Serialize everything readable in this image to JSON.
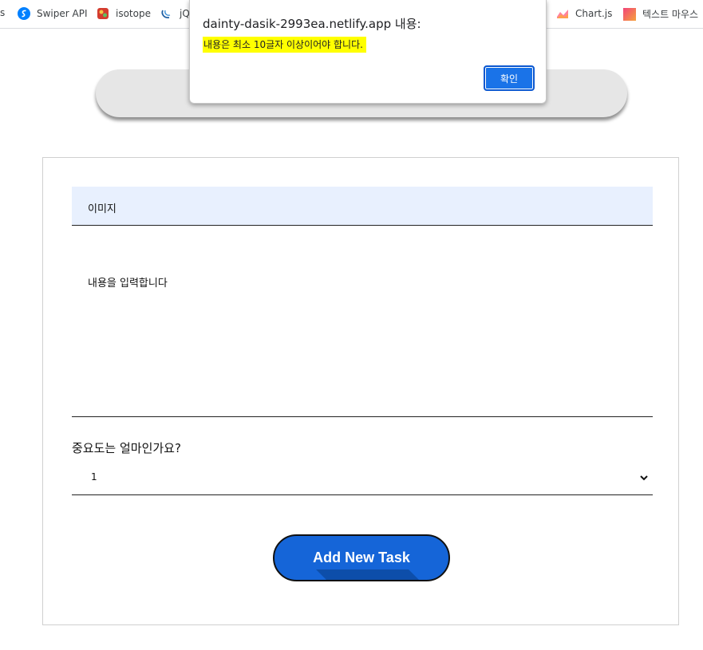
{
  "bookmarks": {
    "truncated_first": "s",
    "items": [
      {
        "label": "Swiper API",
        "icon": "swiper-icon"
      },
      {
        "label": "isotope",
        "icon": "isotope-icon"
      },
      {
        "label": "jQ",
        "icon": "jquery-icon"
      },
      {
        "label": "Chart.js",
        "icon": "chartjs-icon"
      },
      {
        "label": "텍스트 마우스",
        "icon": "bookmark-page-icon"
      }
    ]
  },
  "dialog": {
    "title": "dainty-dasik-2993ea.netlify.app 내용:",
    "message": "내용은 최소 10글자 이상이어야 합니다.",
    "ok_label": "확인"
  },
  "form": {
    "image_label": "이미지",
    "content_placeholder": "내용을 입력합니다",
    "priority_question": "중요도는 얼마인가요?",
    "priority_value": "1",
    "submit_label": "Add New Task"
  },
  "colors": {
    "accent": "#1565d8",
    "dialog_button": "#1a73e8",
    "highlight": "#ffff00",
    "image_row_bg": "#e8f0fe"
  }
}
